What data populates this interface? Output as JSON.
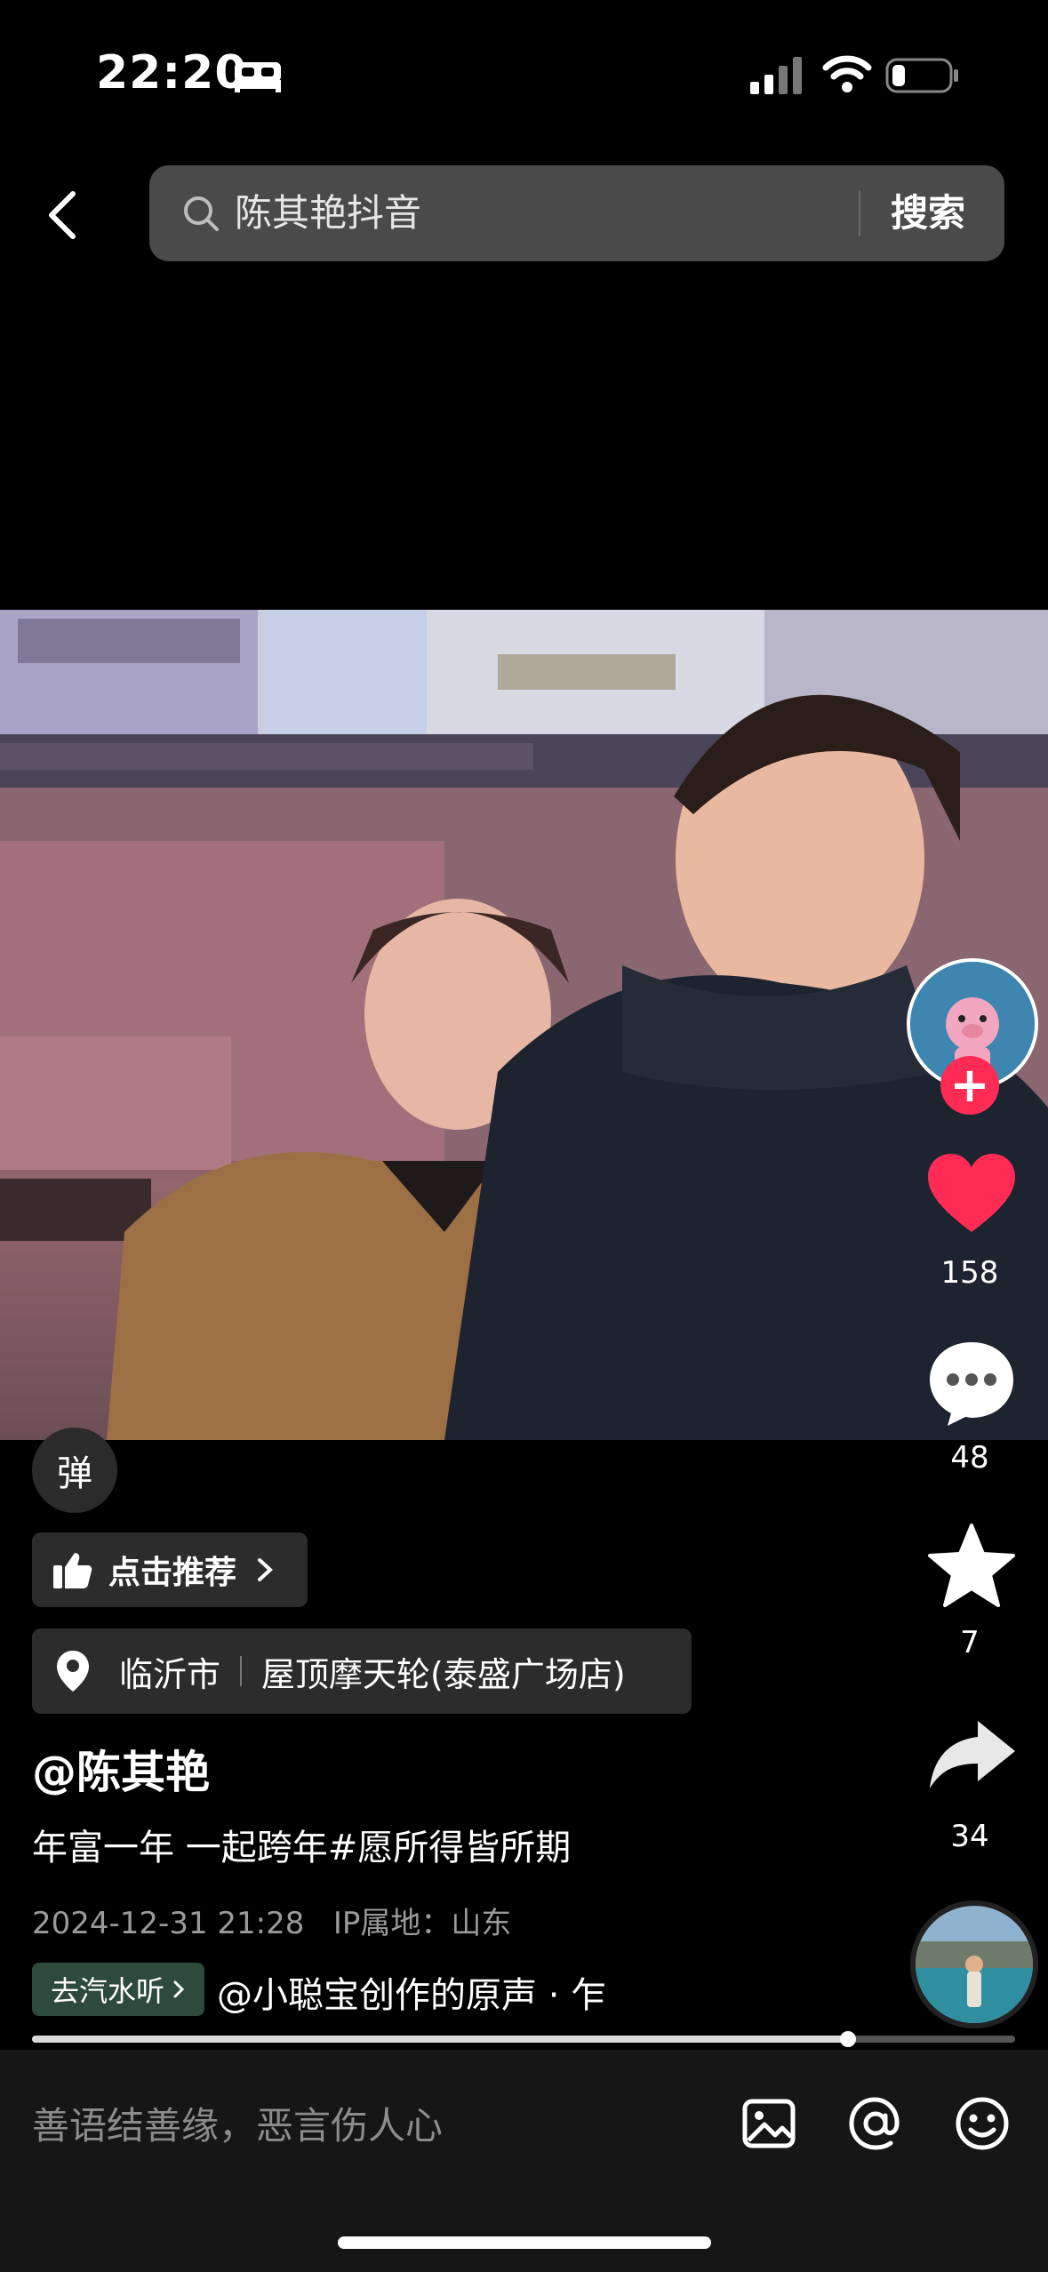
{
  "status_bar": {
    "time": "22:20",
    "icons": [
      "bed-icon",
      "signal-icon",
      "wifi-icon",
      "battery-icon"
    ]
  },
  "header": {
    "search_query": "陈其艳抖音",
    "search_button": "搜索"
  },
  "video": {
    "danmu_label": "弹"
  },
  "actions": {
    "likes": "158",
    "comments": "48",
    "favorites": "7",
    "shares": "34",
    "accent_color": "#fe2c55"
  },
  "info": {
    "recommend_label": "点击推荐",
    "location_city": "临沂市",
    "location_place": "屋顶摩天轮(泰盛广场店)",
    "author": "@陈其艳",
    "description": "年富一年 一起跨年#愿所得皆所期",
    "timestamp": "2024-12-31 21:28",
    "ip_location": "IP属地：山东",
    "music_tag": "去汽水听",
    "music_text": "@小聪宝创作的原声 · 乍"
  },
  "playback": {
    "progress_fraction": 0.83
  },
  "bottom_bar": {
    "comment_placeholder": "善语结善缘，恶言伤人心"
  }
}
